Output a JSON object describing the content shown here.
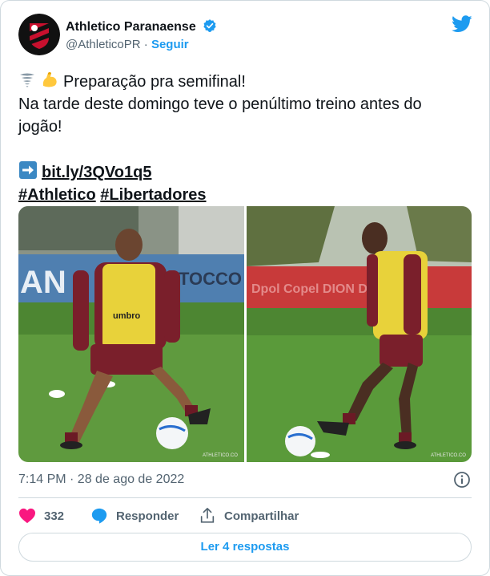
{
  "account": {
    "name": "Athletico Paranaense",
    "handle": "@AthleticoPR",
    "separator": "·",
    "follow_label": "Seguir"
  },
  "tweet": {
    "line1": "Preparação pra semifinal!",
    "line2": "Na tarde deste domingo teve o penúltimo treino antes do",
    "line3": "jogão!",
    "link": "bit.ly/3QVo1q5",
    "hashtag1": "#Athletico",
    "hashtag2": "#Libertadores"
  },
  "photos": {
    "left": {
      "banner": "AN",
      "banner2": "TOCCO",
      "vest_text": "umbro",
      "watermark": "ATHLETICO.CO"
    },
    "right": {
      "banner": "Dpol  Copel  DION DUR",
      "watermark": "ATHLETICO.CO"
    }
  },
  "meta": {
    "timestamp": "7:14 PM · 28 de ago de 2022"
  },
  "actions": {
    "likes": "332",
    "reply_label": "Responder",
    "share_label": "Compartilhar"
  },
  "replies_button": "Ler 4 respostas",
  "colors": {
    "accent": "#1d9bf0",
    "like": "#f91880",
    "text": "#0f1419",
    "muted": "#536471",
    "border": "#cfd9de"
  },
  "icons": [
    "club-crest-icon",
    "verified-badge-icon",
    "twitter-bird-icon",
    "tornado-emoji-icon",
    "flexed-biceps-emoji-icon",
    "right-arrow-emoji-icon",
    "info-icon",
    "heart-icon",
    "reply-icon",
    "share-icon"
  ]
}
